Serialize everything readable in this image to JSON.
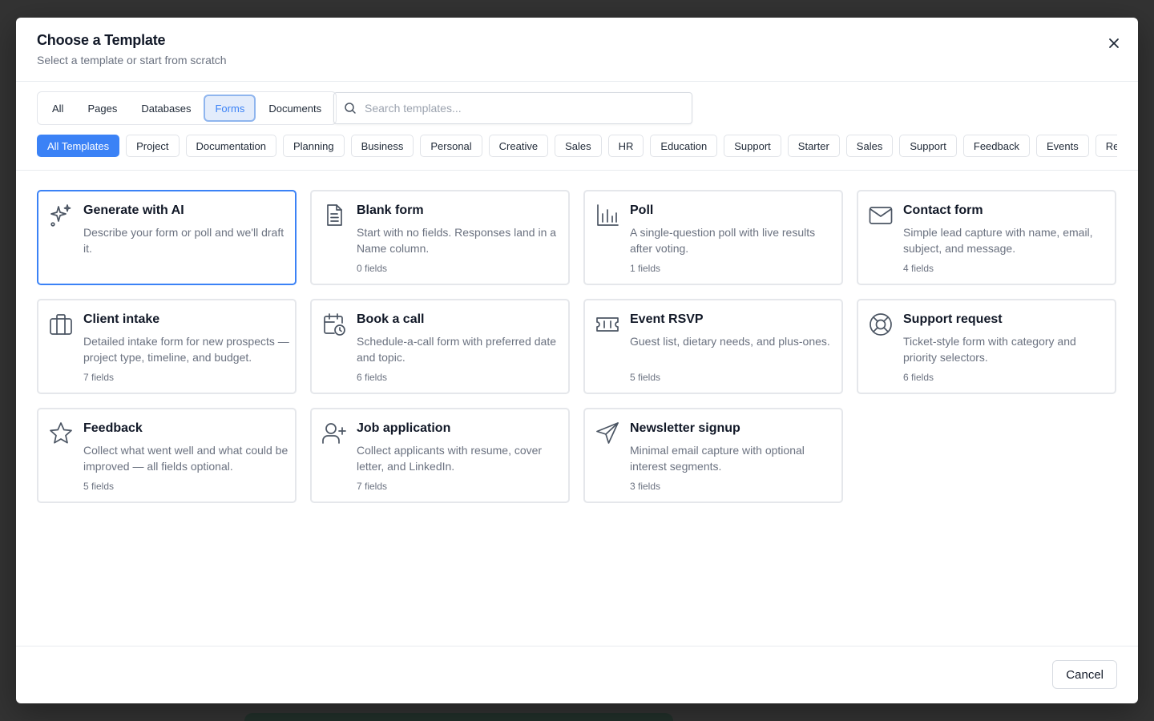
{
  "modal": {
    "title": "Choose a Template",
    "subtitle": "Select a template or start from scratch"
  },
  "type_tabs": [
    {
      "label": "All",
      "active": false
    },
    {
      "label": "Pages",
      "active": false
    },
    {
      "label": "Databases",
      "active": false
    },
    {
      "label": "Forms",
      "active": true
    },
    {
      "label": "Documents",
      "active": false
    }
  ],
  "search": {
    "placeholder": "Search templates...",
    "value": ""
  },
  "categories": [
    {
      "label": "All Templates",
      "active": true
    },
    {
      "label": "Project"
    },
    {
      "label": "Documentation"
    },
    {
      "label": "Planning"
    },
    {
      "label": "Business"
    },
    {
      "label": "Personal"
    },
    {
      "label": "Creative"
    },
    {
      "label": "Sales"
    },
    {
      "label": "HR"
    },
    {
      "label": "Education"
    },
    {
      "label": "Support"
    },
    {
      "label": "Starter"
    },
    {
      "label": "Sales"
    },
    {
      "label": "Support"
    },
    {
      "label": "Feedback"
    },
    {
      "label": "Events"
    },
    {
      "label": "Recruiting"
    }
  ],
  "templates": [
    {
      "icon": "sparkles-icon",
      "title": "Generate with AI",
      "description": "Describe your form or poll and we'll draft it.",
      "fields": "",
      "highlight": true
    },
    {
      "icon": "file-text-icon",
      "title": "Blank form",
      "description": "Start with no fields. Responses land in a Name column.",
      "fields": "0 fields"
    },
    {
      "icon": "bar-chart-icon",
      "title": "Poll",
      "description": "A single-question poll with live results after voting.",
      "fields": "1 fields"
    },
    {
      "icon": "mail-icon",
      "title": "Contact form",
      "description": "Simple lead capture with name, email, subject, and message.",
      "fields": "4 fields"
    },
    {
      "icon": "briefcase-icon",
      "title": "Client intake",
      "description": "Detailed intake form for new prospects — project type, timeline, and budget.",
      "fields": "7 fields"
    },
    {
      "icon": "calendar-clock-icon",
      "title": "Book a call",
      "description": "Schedule-a-call form with preferred date and topic.",
      "fields": "6 fields"
    },
    {
      "icon": "ticket-icon",
      "title": "Event RSVP",
      "description": "Guest list, dietary needs, and plus-ones.",
      "fields": "5 fields"
    },
    {
      "icon": "life-buoy-icon",
      "title": "Support request",
      "description": "Ticket-style form with category and priority selectors.",
      "fields": "6 fields"
    },
    {
      "icon": "star-icon",
      "title": "Feedback",
      "description": "Collect what went well and what could be improved — all fields optional.",
      "fields": "5 fields"
    },
    {
      "icon": "user-plus-icon",
      "title": "Job application",
      "description": "Collect applicants with resume, cover letter, and LinkedIn.",
      "fields": "7 fields"
    },
    {
      "icon": "send-icon",
      "title": "Newsletter signup",
      "description": "Minimal email capture with optional interest segments.",
      "fields": "3 fields"
    }
  ],
  "footer": {
    "cancel_label": "Cancel"
  }
}
